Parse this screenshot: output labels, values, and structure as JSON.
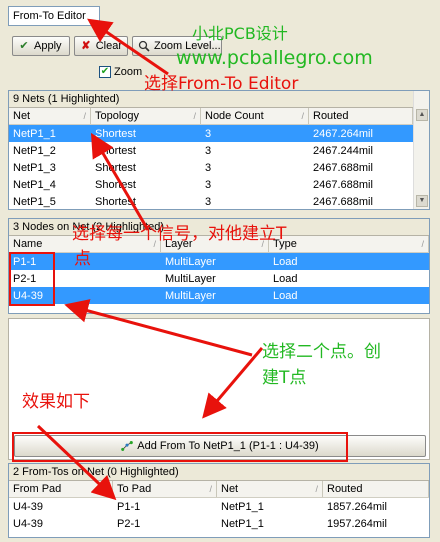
{
  "toolbar": {
    "dropdown_value": "From-To Editor",
    "apply_label": "Apply",
    "clear_label": "Clear",
    "zoom_level_label": "Zoom Level...",
    "zoom_label": "Zoom",
    "zoom_checked": true
  },
  "nets_panel": {
    "title": "9 Nets (1 Highlighted)",
    "columns": [
      "Net",
      "Topology",
      "Node Count",
      "Routed"
    ],
    "rows": [
      [
        "NetP1_1",
        "Shortest",
        "3",
        "2467.264mil"
      ],
      [
        "NetP1_2",
        "Shortest",
        "3",
        "2467.244mil"
      ],
      [
        "NetP1_3",
        "Shortest",
        "3",
        "2467.688mil"
      ],
      [
        "NetP1_4",
        "Shortest",
        "3",
        "2467.688mil"
      ],
      [
        "NetP1_5",
        "Shortest",
        "3",
        "2467.688mil"
      ]
    ],
    "selected_row": 0
  },
  "nodes_panel": {
    "title": "3 Nodes on Net (2 Highlighted)",
    "columns": [
      "Name",
      "Layer",
      "Type"
    ],
    "rows": [
      [
        "P1-1",
        "MultiLayer",
        "Load"
      ],
      [
        "P2-1",
        "MultiLayer",
        "Load"
      ],
      [
        "U4-39",
        "MultiLayer",
        "Load"
      ]
    ],
    "selected_rows": [
      0,
      2
    ]
  },
  "add_button": {
    "label": "Add From To NetP1_1 (P1-1 : U4-39)"
  },
  "fromtos_panel": {
    "title": "2 From-Tos on Net (0 Highlighted)",
    "columns": [
      "From Pad",
      "To Pad",
      "Net",
      "Routed"
    ],
    "rows": [
      [
        "U4-39",
        "P1-1",
        "NetP1_1",
        "1857.264mil"
      ],
      [
        "U4-39",
        "P2-1",
        "NetP1_1",
        "1957.264mil"
      ]
    ]
  },
  "annotations": {
    "watermark_line1": "小北PCB设计",
    "watermark_line2": "www.pcballegro.com",
    "step1": "选择From-To Editor",
    "step2_line1": "选择每一个信号，对他建立T",
    "step2_line2": "点",
    "step3_line1": "选择二个点。创",
    "step3_line2": "建T点",
    "result": "效果如下"
  },
  "colors": {
    "annotation_red": "#e8120c",
    "annotation_green": "#22b822",
    "selection_blue": "#3399ff"
  }
}
